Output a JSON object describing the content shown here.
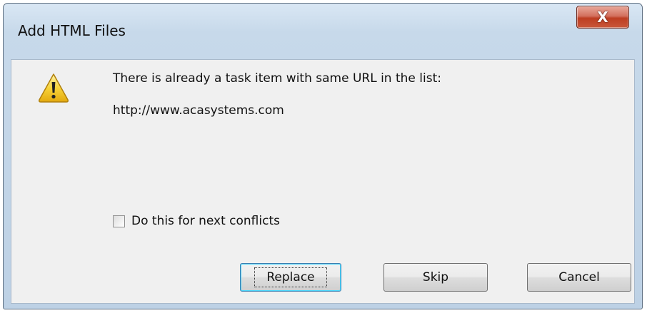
{
  "window": {
    "title": "Add HTML Files",
    "close_symbol": "X"
  },
  "dialog": {
    "icon": "warning-icon",
    "message": "There is already a task item with same URL in the list:",
    "url": "http://www.acasystems.com",
    "checkbox": {
      "label": "Do this for next conflicts",
      "checked": false
    },
    "buttons": {
      "replace": "Replace",
      "skip": "Skip",
      "cancel": "Cancel"
    }
  },
  "colors": {
    "close_button": "#c9573a",
    "dialog_background": "#f0f0f0",
    "frame": "#c7d9ea",
    "focus_glow": "#48d5fb"
  }
}
